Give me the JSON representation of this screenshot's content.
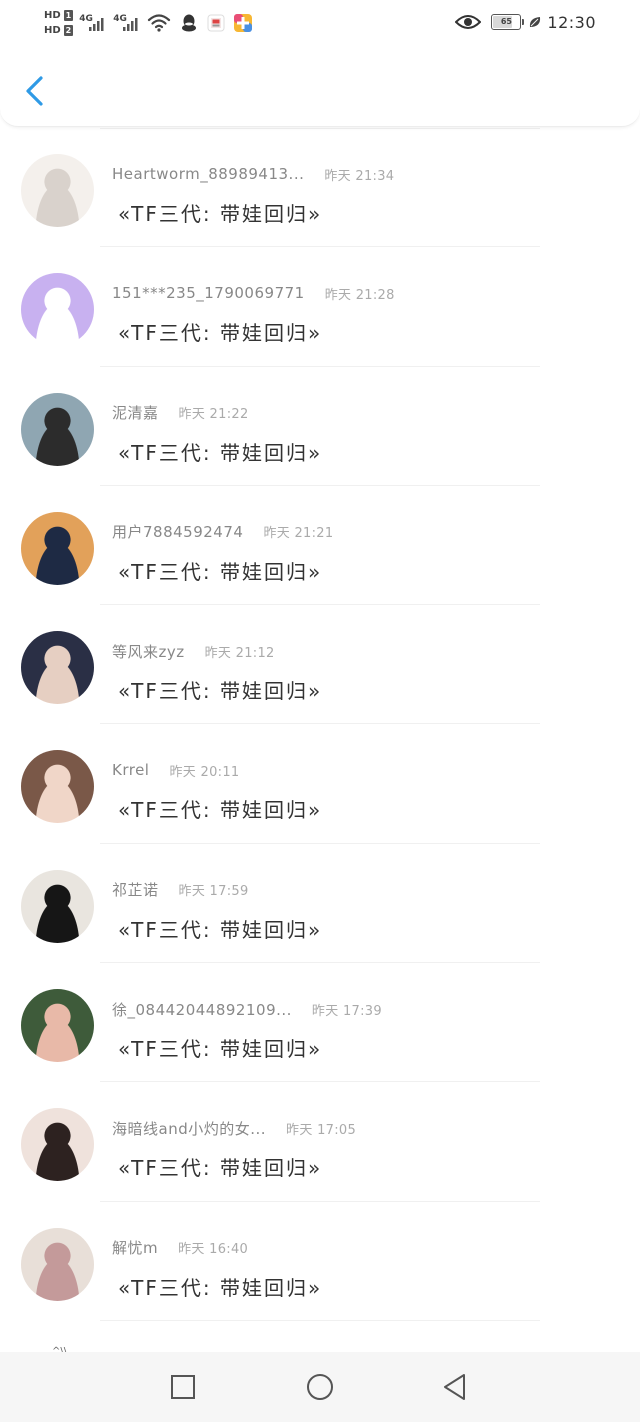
{
  "status_bar": {
    "sim1": "HD",
    "sim1_slot": "1",
    "sim2": "HD",
    "sim2_slot": "2",
    "network1": "4G",
    "network2": "4G",
    "battery_level": "65",
    "time": "12:30"
  },
  "header": {
    "back_icon": "chevron-left-icon",
    "accent_color": "#2f9ae6"
  },
  "messages": [
    {
      "name": "Heartworm_88989413...",
      "time": "昨天 21:34",
      "text": "«TF三代: 带娃回归»",
      "avatar_colors": [
        "#f4f0ec",
        "#d9d2cc"
      ]
    },
    {
      "name": "151***235_1790069771",
      "time": "昨天 21:28",
      "text": "«TF三代: 带娃回归»",
      "avatar_colors": [
        "#c8b1f0",
        "#ffffff"
      ]
    },
    {
      "name": "泥清嘉",
      "time": "昨天 21:22",
      "text": "«TF三代: 带娃回归»",
      "avatar_colors": [
        "#8fa6b2",
        "#2c2c2c"
      ]
    },
    {
      "name": "用户7884592474",
      "time": "昨天 21:21",
      "text": "«TF三代: 带娃回归»",
      "avatar_colors": [
        "#e2a15a",
        "#1e2a44"
      ]
    },
    {
      "name": "等风来zyz",
      "time": "昨天 21:12",
      "text": "«TF三代: 带娃回归»",
      "avatar_colors": [
        "#2a2f45",
        "#e6cfc2"
      ]
    },
    {
      "name": "Krrel",
      "time": "昨天 20:11",
      "text": "«TF三代: 带娃回归»",
      "avatar_colors": [
        "#7a5848",
        "#f0d6c8"
      ]
    },
    {
      "name": "祁芷诺",
      "time": "昨天 17:59",
      "text": "«TF三代: 带娃回归»",
      "avatar_colors": [
        "#e9e5df",
        "#161616"
      ]
    },
    {
      "name": "徐_08442044892109...",
      "time": "昨天 17:39",
      "text": "«TF三代: 带娃回归»",
      "avatar_colors": [
        "#3e5b3a",
        "#e8b9a8"
      ]
    },
    {
      "name": "海暗线and小灼的女...",
      "time": "昨天 17:05",
      "text": "«TF三代: 带娃回归»",
      "avatar_colors": [
        "#efe2dc",
        "#2d2220"
      ]
    },
    {
      "name": "解忧m",
      "time": "昨天 16:40",
      "text": "«TF三代: 带娃回归»",
      "avatar_colors": [
        "#e8dfd8",
        "#c49a9a"
      ]
    }
  ],
  "peek_text": "^\\\\",
  "nav_bar": {
    "recents_icon": "square-icon",
    "home_icon": "circle-icon",
    "back_icon": "triangle-back-icon"
  }
}
